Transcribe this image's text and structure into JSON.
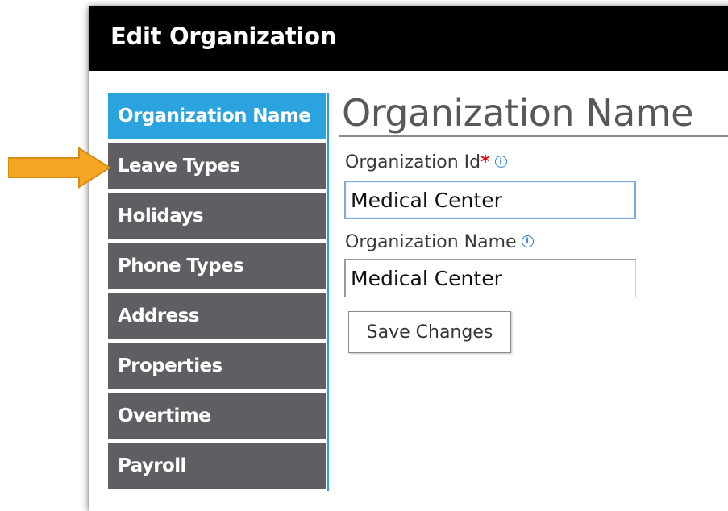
{
  "window": {
    "title": "Edit Organization"
  },
  "sidebar": {
    "items": [
      {
        "label": "Organization Name",
        "active": true
      },
      {
        "label": "Leave Types",
        "active": false
      },
      {
        "label": "Holidays",
        "active": false
      },
      {
        "label": "Phone Types",
        "active": false
      },
      {
        "label": "Address",
        "active": false
      },
      {
        "label": "Properties",
        "active": false
      },
      {
        "label": "Overtime",
        "active": false
      },
      {
        "label": "Payroll",
        "active": false
      }
    ]
  },
  "main": {
    "title": "Organization Name",
    "org_id": {
      "label": "Organization Id",
      "required_mark": "*",
      "value": "Medical Center"
    },
    "org_name": {
      "label": "Organization Name",
      "value": "Medical Center"
    },
    "save_label": "Save Changes"
  },
  "icons": {
    "info": "info-icon",
    "pointer": "arrow-right-icon"
  },
  "colors": {
    "titlebar": "#000000",
    "active_nav": "#2aa3df",
    "nav": "#605e62",
    "required": "#e00000",
    "arrow": "#f5a623"
  }
}
